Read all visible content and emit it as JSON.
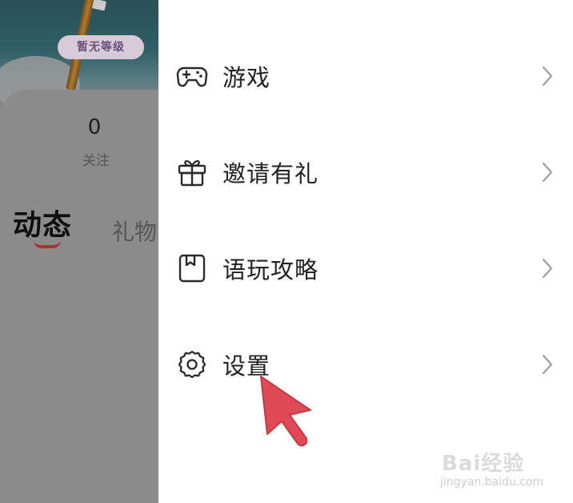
{
  "profile": {
    "level_badge": "暂无等级",
    "follow_count": "0",
    "follow_label": "关注",
    "tabs": [
      {
        "label": "动态",
        "active": true
      },
      {
        "label": "礼物",
        "active": false
      }
    ]
  },
  "drawer_menu": {
    "items": [
      {
        "label": "游戏",
        "icon": "gamepad-icon"
      },
      {
        "label": "邀请有礼",
        "icon": "gift-icon"
      },
      {
        "label": "语玩攻略",
        "icon": "guide-book-icon"
      },
      {
        "label": "设置",
        "icon": "gear-icon"
      }
    ],
    "chevron_icon": "chevron-right-icon"
  },
  "annotation": {
    "pointer": "red-arrow-icon",
    "pointer_color": "#de4a55"
  },
  "watermark": {
    "brand": "Bai经验",
    "url": "jingyan.baidu.com"
  },
  "colors": {
    "overlay_gray": "#8b8b8b",
    "active_tab_underline": "#b52e2e",
    "icon_stroke": "#2a2a2a",
    "chevron": "#9e9e9e"
  }
}
